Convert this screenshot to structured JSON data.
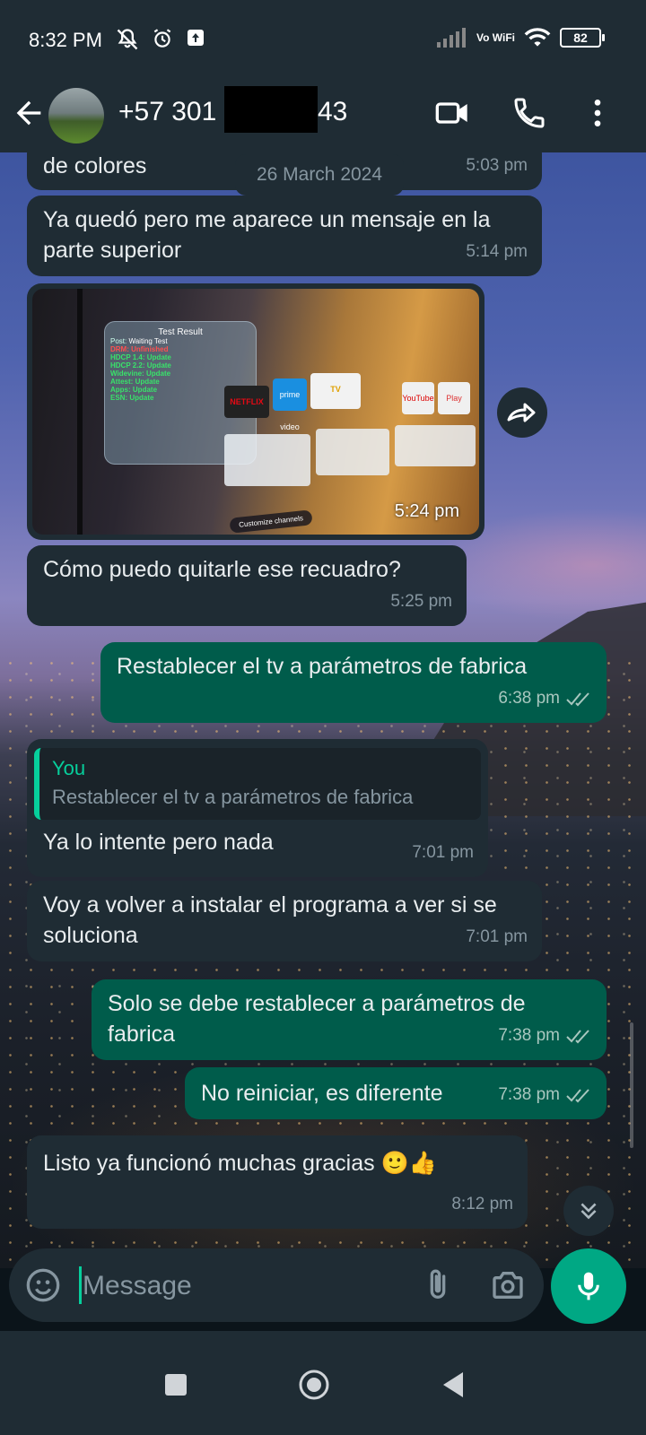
{
  "status_bar": {
    "time": "8:32 PM",
    "network": "Vo WiFi",
    "battery": "82",
    "icons": [
      "mute-icon",
      "alarm-icon",
      "upload-icon",
      "signal-icon",
      "wifi-icon",
      "battery-icon"
    ]
  },
  "header": {
    "contact_prefix": "+57 301",
    "contact_suffix": "43",
    "icons": [
      "back-arrow-icon",
      "video-call-icon",
      "phone-call-icon",
      "more-vert-icon"
    ]
  },
  "chat": {
    "date_chip": "26 March 2024",
    "messages": [
      {
        "dir": "in",
        "text": "de colores",
        "time": "5:03 pm"
      },
      {
        "dir": "in",
        "text": "Ya quedó pero me aparece un mensaje en la parte superior",
        "time": "5:14 pm"
      },
      {
        "dir": "in",
        "type": "image",
        "time": "5:24 pm"
      },
      {
        "dir": "in",
        "text": "Cómo puedo quitarle ese recuadro?",
        "time": "5:25 pm"
      },
      {
        "dir": "out",
        "text": "Restablecer el tv a parámetros de fabrica",
        "time": "6:38 pm"
      },
      {
        "dir": "in",
        "text": "Ya lo intente pero nada",
        "time": "7:01 pm",
        "quote_author": "You",
        "quote_text": "Restablecer el tv a parámetros de fabrica"
      },
      {
        "dir": "in",
        "text": "Voy a volver a instalar el programa a ver si se soluciona",
        "time": "7:01 pm"
      },
      {
        "dir": "out",
        "text": "Solo se debe restablecer a parámetros de fabrica",
        "time": "7:38 pm"
      },
      {
        "dir": "out",
        "text": "No reiniciar, es diferente",
        "time": "7:38 pm"
      },
      {
        "dir": "in",
        "text": "Listo ya funcionó muchas gracias 🙂👍",
        "time": "8:12 pm"
      }
    ],
    "image": {
      "test_title": "Test Result",
      "rows": [
        {
          "label": "Post:",
          "value": "Waiting Test"
        },
        {
          "label": "DRM:",
          "value": "Unfinished"
        },
        {
          "label": "HDCP 1.4:",
          "value": "Update"
        },
        {
          "label": "HDCP 2.2:",
          "value": "Update"
        },
        {
          "label": "Widevine:",
          "value": "Update"
        },
        {
          "label": "Attest:",
          "value": "Update"
        },
        {
          "label": "Apps:",
          "value": "Update"
        },
        {
          "label": "ESN:",
          "value": "Update"
        }
      ],
      "apps": [
        "NETFLIX",
        "prime video",
        "TV",
        "YouTube",
        "Play"
      ],
      "customize": "Customize channels"
    }
  },
  "composer": {
    "placeholder": "Message"
  },
  "colors": {
    "incoming_bubble": "#1f2c34",
    "outgoing_bubble": "#005c4b",
    "accent": "#00a884"
  }
}
